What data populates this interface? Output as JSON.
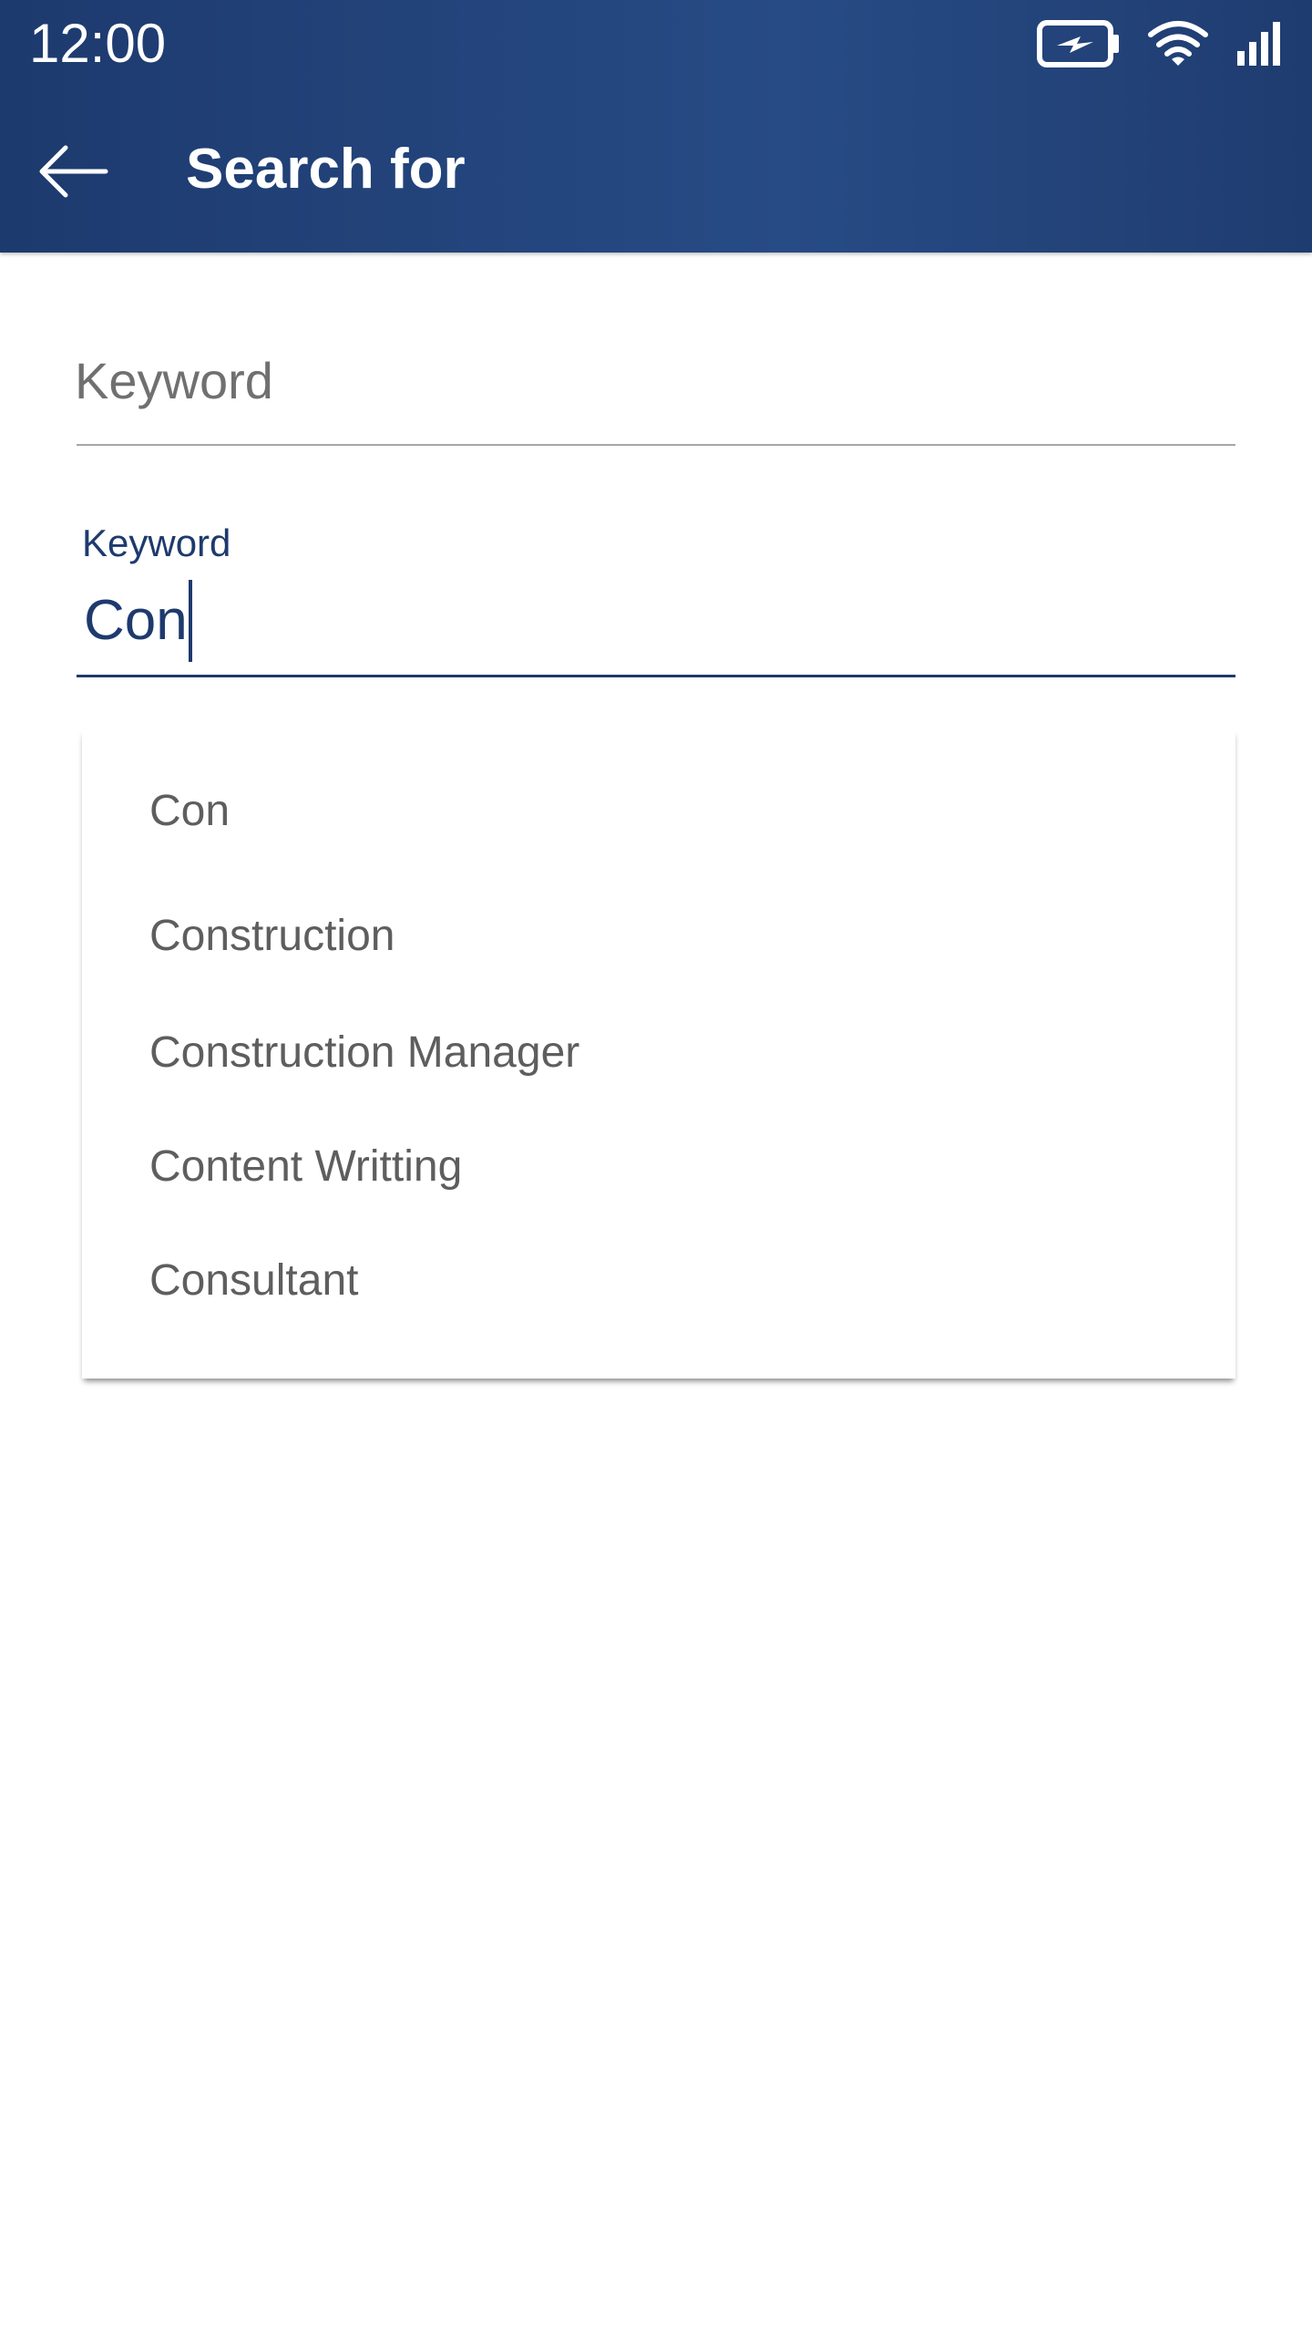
{
  "status_bar": {
    "time": "12:00",
    "icons": [
      "battery-charging-icon",
      "wifi-icon",
      "cellular-signal-icon"
    ]
  },
  "app_bar": {
    "back_icon": "arrow-left-icon",
    "title": "Search for"
  },
  "fields": {
    "first": {
      "placeholder": "Keyword",
      "value": ""
    },
    "second": {
      "label": "Keyword",
      "value": "Con"
    }
  },
  "suggestions": [
    "Con",
    "Construction",
    "Construction Manager",
    "Content Writting",
    "Consultant"
  ],
  "colors": {
    "primary": "#1e3a6e",
    "appbar_gradient": [
      "#1d3a6e",
      "#274b85"
    ],
    "suggestion_text": "#5e5e5e",
    "placeholder_text": "#707070"
  }
}
